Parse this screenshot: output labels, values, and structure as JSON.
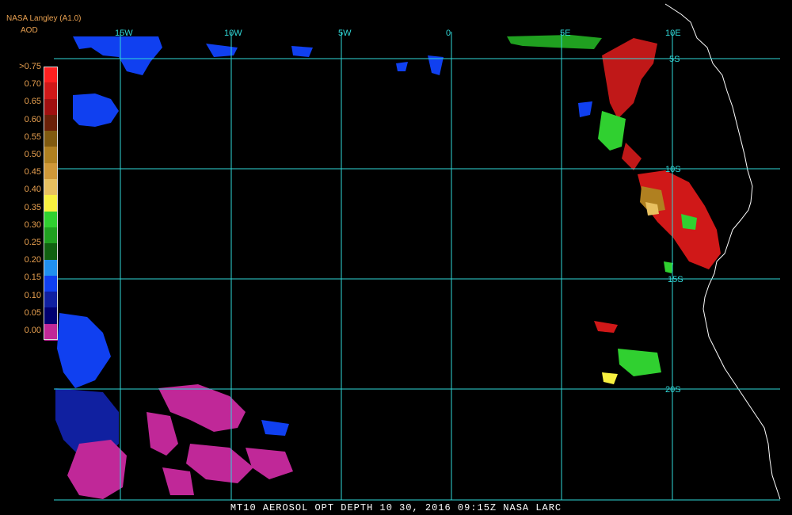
{
  "header": {
    "brand": "NASA Langley (A1.0)",
    "unit": "AOD"
  },
  "legend": {
    "ticks": [
      ">0.75",
      "0.70",
      "0.65",
      "0.60",
      "0.55",
      "0.50",
      "0.45",
      "0.40",
      "0.35",
      "0.30",
      "0.25",
      "0.20",
      "0.15",
      "0.10",
      "0.05",
      "0.00"
    ],
    "colors": [
      "#ff2020",
      "#d01818",
      "#a01010",
      "#6a2008",
      "#805a10",
      "#b08020",
      "#d09838",
      "#e8c060",
      "#f8f040",
      "#30d030",
      "#20a020",
      "#106010",
      "#2090f0",
      "#1040f0",
      "#1020a0",
      "#000070",
      "#c02898"
    ]
  },
  "grid": {
    "lon_labels": [
      "15W",
      "10W",
      "5W",
      "0",
      "5E",
      "10E"
    ],
    "lat_labels": [
      "5S",
      "10S",
      "15S",
      "20S"
    ],
    "line_color": "#30d8d8",
    "coast_color": "#ffffff"
  },
  "footer": {
    "text": "MT10  AEROSOL OPT DEPTH   10 30, 2016 09:15Z   NASA LARC"
  }
}
